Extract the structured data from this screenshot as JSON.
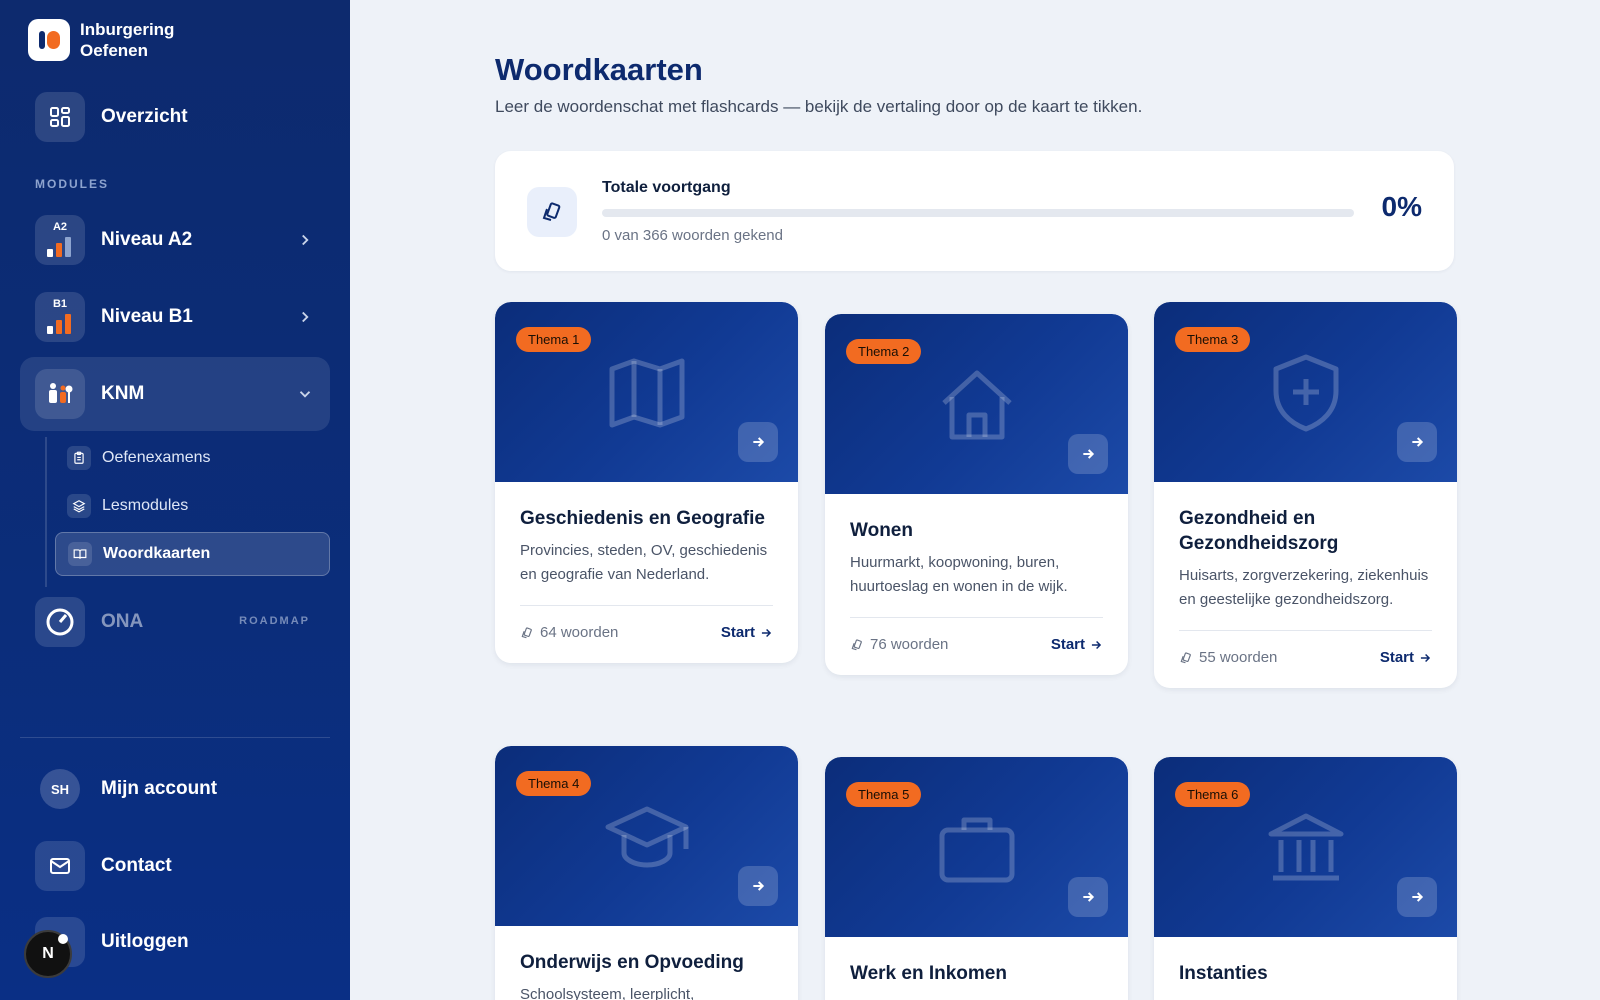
{
  "brand": {
    "line1": "Inburgering",
    "line2": "Oefenen"
  },
  "sidebar": {
    "overview": "Overzicht",
    "section_label": "MODULES",
    "a2": {
      "label": "Niveau A2",
      "badge": "A2"
    },
    "b1": {
      "label": "Niveau B1",
      "badge": "B1"
    },
    "knm": {
      "label": "KNM"
    },
    "sub": [
      "Oefenexamens",
      "Lesmodules",
      "Woordkaarten"
    ],
    "ona": {
      "label": "ONA",
      "tag": "ROADMAP"
    },
    "account": {
      "label": "Mijn account",
      "initials": "SH"
    },
    "contact": "Contact",
    "logout": "Uitloggen",
    "dev_badge": "N"
  },
  "page": {
    "title": "Woordkaarten",
    "subtitle": "Leer de woordenschat met flashcards — bekijk de vertaling door op de kaart te tikken."
  },
  "progress": {
    "title": "Totale voortgang",
    "count_text": "0 van 366 woorden gekend",
    "percent_text": "0%",
    "fraction": 0
  },
  "cards": [
    {
      "thema": "Thema 1",
      "title": "Geschiedenis en Geografie",
      "desc": "Provincies, steden, OV, geschiedenis en geografie van Nederland.",
      "words": "64 woorden",
      "start": "Start",
      "icon": "map-icon"
    },
    {
      "thema": "Thema 2",
      "title": "Wonen",
      "desc": "Huurmarkt, koopwoning, buren, huurtoeslag en wonen in de wijk.",
      "words": "76 woorden",
      "start": "Start",
      "icon": "house-icon"
    },
    {
      "thema": "Thema 3",
      "title": "Gezondheid en Gezondheidszorg",
      "desc": "Huisarts, zorgverzekering, ziekenhuis en geestelijke gezondheidszorg.",
      "words": "55 woorden",
      "start": "Start",
      "icon": "shield-plus-icon"
    },
    {
      "thema": "Thema 4",
      "title": "Onderwijs en Opvoeding",
      "desc": "Schoolsysteem, leerplicht,",
      "icon": "graduation-cap-icon"
    },
    {
      "thema": "Thema 5",
      "title": "Werk en Inkomen",
      "desc": "",
      "icon": "briefcase-icon"
    },
    {
      "thema": "Thema 6",
      "title": "Instanties",
      "desc": "",
      "icon": "bank-icon"
    }
  ],
  "colors": {
    "accent": "#f26b21",
    "navy": "#0d2a6e",
    "background": "#eef2f8"
  }
}
